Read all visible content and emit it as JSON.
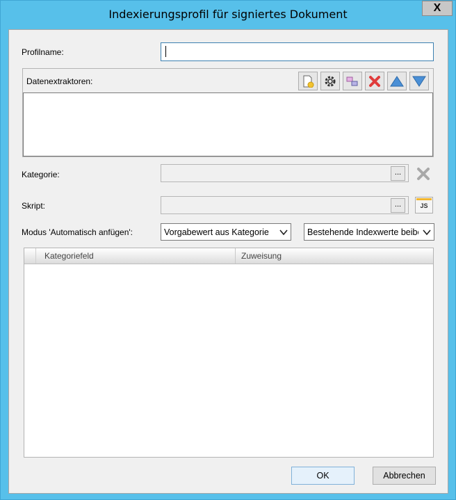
{
  "window": {
    "title": "Indexierungsprofil für signiertes Dokument",
    "close_label": "X"
  },
  "profile": {
    "label": "Profilname:",
    "value": ""
  },
  "extractors": {
    "label": "Datenextraktoren:",
    "toolbar": [
      "new-document-icon",
      "gear-icon",
      "link-icon",
      "delete-icon",
      "up-arrow-icon",
      "down-arrow-icon"
    ]
  },
  "category": {
    "label": "Kategorie:",
    "browse_label": "..."
  },
  "script": {
    "label": "Skript:",
    "browse_label": "...",
    "js_label": "JS"
  },
  "mode": {
    "label": "Modus 'Automatisch anfügen':",
    "select1_value": "Vorgabewert aus Kategorie",
    "select2_value": "Bestehende Indexwerte beibehalten"
  },
  "grid": {
    "columns": [
      "Kategoriefeld",
      "Zuweisung"
    ]
  },
  "buttons": {
    "ok": "OK",
    "cancel": "Abbrechen"
  }
}
